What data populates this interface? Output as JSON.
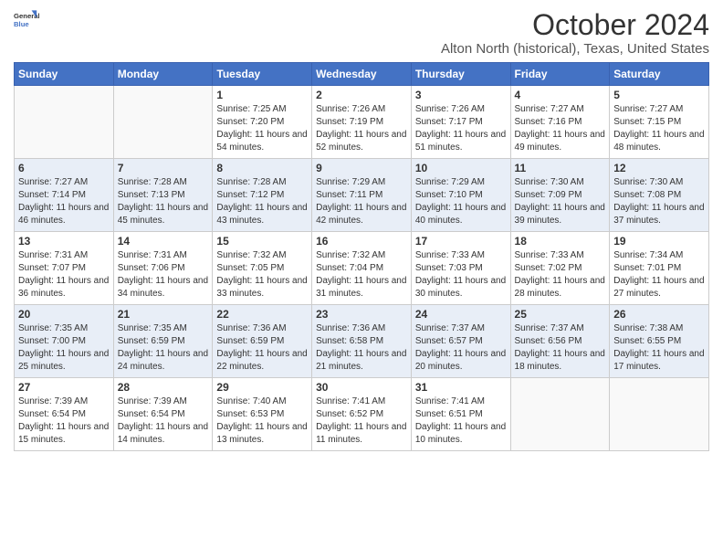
{
  "logo": {
    "line1": "General",
    "line2": "Blue"
  },
  "title": "October 2024",
  "subtitle": "Alton North (historical), Texas, United States",
  "days_header": [
    "Sunday",
    "Monday",
    "Tuesday",
    "Wednesday",
    "Thursday",
    "Friday",
    "Saturday"
  ],
  "weeks": [
    [
      {
        "day": "",
        "sunrise": "",
        "sunset": "",
        "daylight": ""
      },
      {
        "day": "",
        "sunrise": "",
        "sunset": "",
        "daylight": ""
      },
      {
        "day": "1",
        "sunrise": "Sunrise: 7:25 AM",
        "sunset": "Sunset: 7:20 PM",
        "daylight": "Daylight: 11 hours and 54 minutes."
      },
      {
        "day": "2",
        "sunrise": "Sunrise: 7:26 AM",
        "sunset": "Sunset: 7:19 PM",
        "daylight": "Daylight: 11 hours and 52 minutes."
      },
      {
        "day": "3",
        "sunrise": "Sunrise: 7:26 AM",
        "sunset": "Sunset: 7:17 PM",
        "daylight": "Daylight: 11 hours and 51 minutes."
      },
      {
        "day": "4",
        "sunrise": "Sunrise: 7:27 AM",
        "sunset": "Sunset: 7:16 PM",
        "daylight": "Daylight: 11 hours and 49 minutes."
      },
      {
        "day": "5",
        "sunrise": "Sunrise: 7:27 AM",
        "sunset": "Sunset: 7:15 PM",
        "daylight": "Daylight: 11 hours and 48 minutes."
      }
    ],
    [
      {
        "day": "6",
        "sunrise": "Sunrise: 7:27 AM",
        "sunset": "Sunset: 7:14 PM",
        "daylight": "Daylight: 11 hours and 46 minutes."
      },
      {
        "day": "7",
        "sunrise": "Sunrise: 7:28 AM",
        "sunset": "Sunset: 7:13 PM",
        "daylight": "Daylight: 11 hours and 45 minutes."
      },
      {
        "day": "8",
        "sunrise": "Sunrise: 7:28 AM",
        "sunset": "Sunset: 7:12 PM",
        "daylight": "Daylight: 11 hours and 43 minutes."
      },
      {
        "day": "9",
        "sunrise": "Sunrise: 7:29 AM",
        "sunset": "Sunset: 7:11 PM",
        "daylight": "Daylight: 11 hours and 42 minutes."
      },
      {
        "day": "10",
        "sunrise": "Sunrise: 7:29 AM",
        "sunset": "Sunset: 7:10 PM",
        "daylight": "Daylight: 11 hours and 40 minutes."
      },
      {
        "day": "11",
        "sunrise": "Sunrise: 7:30 AM",
        "sunset": "Sunset: 7:09 PM",
        "daylight": "Daylight: 11 hours and 39 minutes."
      },
      {
        "day": "12",
        "sunrise": "Sunrise: 7:30 AM",
        "sunset": "Sunset: 7:08 PM",
        "daylight": "Daylight: 11 hours and 37 minutes."
      }
    ],
    [
      {
        "day": "13",
        "sunrise": "Sunrise: 7:31 AM",
        "sunset": "Sunset: 7:07 PM",
        "daylight": "Daylight: 11 hours and 36 minutes."
      },
      {
        "day": "14",
        "sunrise": "Sunrise: 7:31 AM",
        "sunset": "Sunset: 7:06 PM",
        "daylight": "Daylight: 11 hours and 34 minutes."
      },
      {
        "day": "15",
        "sunrise": "Sunrise: 7:32 AM",
        "sunset": "Sunset: 7:05 PM",
        "daylight": "Daylight: 11 hours and 33 minutes."
      },
      {
        "day": "16",
        "sunrise": "Sunrise: 7:32 AM",
        "sunset": "Sunset: 7:04 PM",
        "daylight": "Daylight: 11 hours and 31 minutes."
      },
      {
        "day": "17",
        "sunrise": "Sunrise: 7:33 AM",
        "sunset": "Sunset: 7:03 PM",
        "daylight": "Daylight: 11 hours and 30 minutes."
      },
      {
        "day": "18",
        "sunrise": "Sunrise: 7:33 AM",
        "sunset": "Sunset: 7:02 PM",
        "daylight": "Daylight: 11 hours and 28 minutes."
      },
      {
        "day": "19",
        "sunrise": "Sunrise: 7:34 AM",
        "sunset": "Sunset: 7:01 PM",
        "daylight": "Daylight: 11 hours and 27 minutes."
      }
    ],
    [
      {
        "day": "20",
        "sunrise": "Sunrise: 7:35 AM",
        "sunset": "Sunset: 7:00 PM",
        "daylight": "Daylight: 11 hours and 25 minutes."
      },
      {
        "day": "21",
        "sunrise": "Sunrise: 7:35 AM",
        "sunset": "Sunset: 6:59 PM",
        "daylight": "Daylight: 11 hours and 24 minutes."
      },
      {
        "day": "22",
        "sunrise": "Sunrise: 7:36 AM",
        "sunset": "Sunset: 6:59 PM",
        "daylight": "Daylight: 11 hours and 22 minutes."
      },
      {
        "day": "23",
        "sunrise": "Sunrise: 7:36 AM",
        "sunset": "Sunset: 6:58 PM",
        "daylight": "Daylight: 11 hours and 21 minutes."
      },
      {
        "day": "24",
        "sunrise": "Sunrise: 7:37 AM",
        "sunset": "Sunset: 6:57 PM",
        "daylight": "Daylight: 11 hours and 20 minutes."
      },
      {
        "day": "25",
        "sunrise": "Sunrise: 7:37 AM",
        "sunset": "Sunset: 6:56 PM",
        "daylight": "Daylight: 11 hours and 18 minutes."
      },
      {
        "day": "26",
        "sunrise": "Sunrise: 7:38 AM",
        "sunset": "Sunset: 6:55 PM",
        "daylight": "Daylight: 11 hours and 17 minutes."
      }
    ],
    [
      {
        "day": "27",
        "sunrise": "Sunrise: 7:39 AM",
        "sunset": "Sunset: 6:54 PM",
        "daylight": "Daylight: 11 hours and 15 minutes."
      },
      {
        "day": "28",
        "sunrise": "Sunrise: 7:39 AM",
        "sunset": "Sunset: 6:54 PM",
        "daylight": "Daylight: 11 hours and 14 minutes."
      },
      {
        "day": "29",
        "sunrise": "Sunrise: 7:40 AM",
        "sunset": "Sunset: 6:53 PM",
        "daylight": "Daylight: 11 hours and 13 minutes."
      },
      {
        "day": "30",
        "sunrise": "Sunrise: 7:41 AM",
        "sunset": "Sunset: 6:52 PM",
        "daylight": "Daylight: 11 hours and 11 minutes."
      },
      {
        "day": "31",
        "sunrise": "Sunrise: 7:41 AM",
        "sunset": "Sunset: 6:51 PM",
        "daylight": "Daylight: 11 hours and 10 minutes."
      },
      {
        "day": "",
        "sunrise": "",
        "sunset": "",
        "daylight": ""
      },
      {
        "day": "",
        "sunrise": "",
        "sunset": "",
        "daylight": ""
      }
    ]
  ]
}
